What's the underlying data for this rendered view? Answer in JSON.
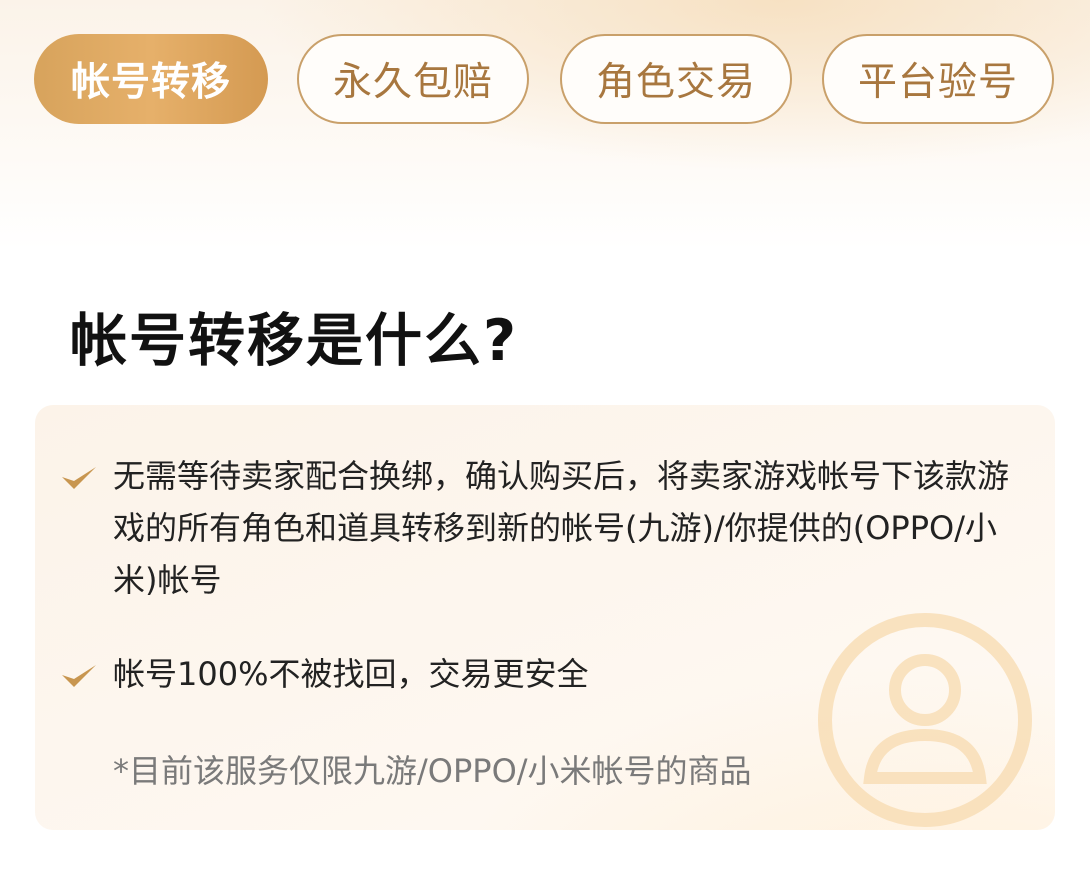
{
  "tabs": [
    {
      "label": "帐号转移",
      "active": true
    },
    {
      "label": "永久包赔",
      "active": false
    },
    {
      "label": "角色交易",
      "active": false
    },
    {
      "label": "平台验号",
      "active": false
    }
  ],
  "section": {
    "title": "帐号转移是什么?",
    "items": [
      {
        "text": "无需等待卖家配合换绑，确认购买后，将卖家游戏帐号下该款游戏的所有角色和道具转移到新的帐号(九游)/你提供的(OPPO/小米)帐号"
      },
      {
        "text": "帐号100%不被找回，交易更安全"
      }
    ],
    "note": "*目前该服务仅限九游/OPPO/小米帐号的商品"
  },
  "icons": {
    "check": "check-icon",
    "watermark": "user-shield-watermark-icon"
  },
  "colors": {
    "accent": "#D9A35E",
    "tab_border": "#C9A06A",
    "tab_text": "#A8773F",
    "check": "#C89650",
    "title": "#111111",
    "body_text": "#222222",
    "note_text": "#7A7A7A"
  }
}
